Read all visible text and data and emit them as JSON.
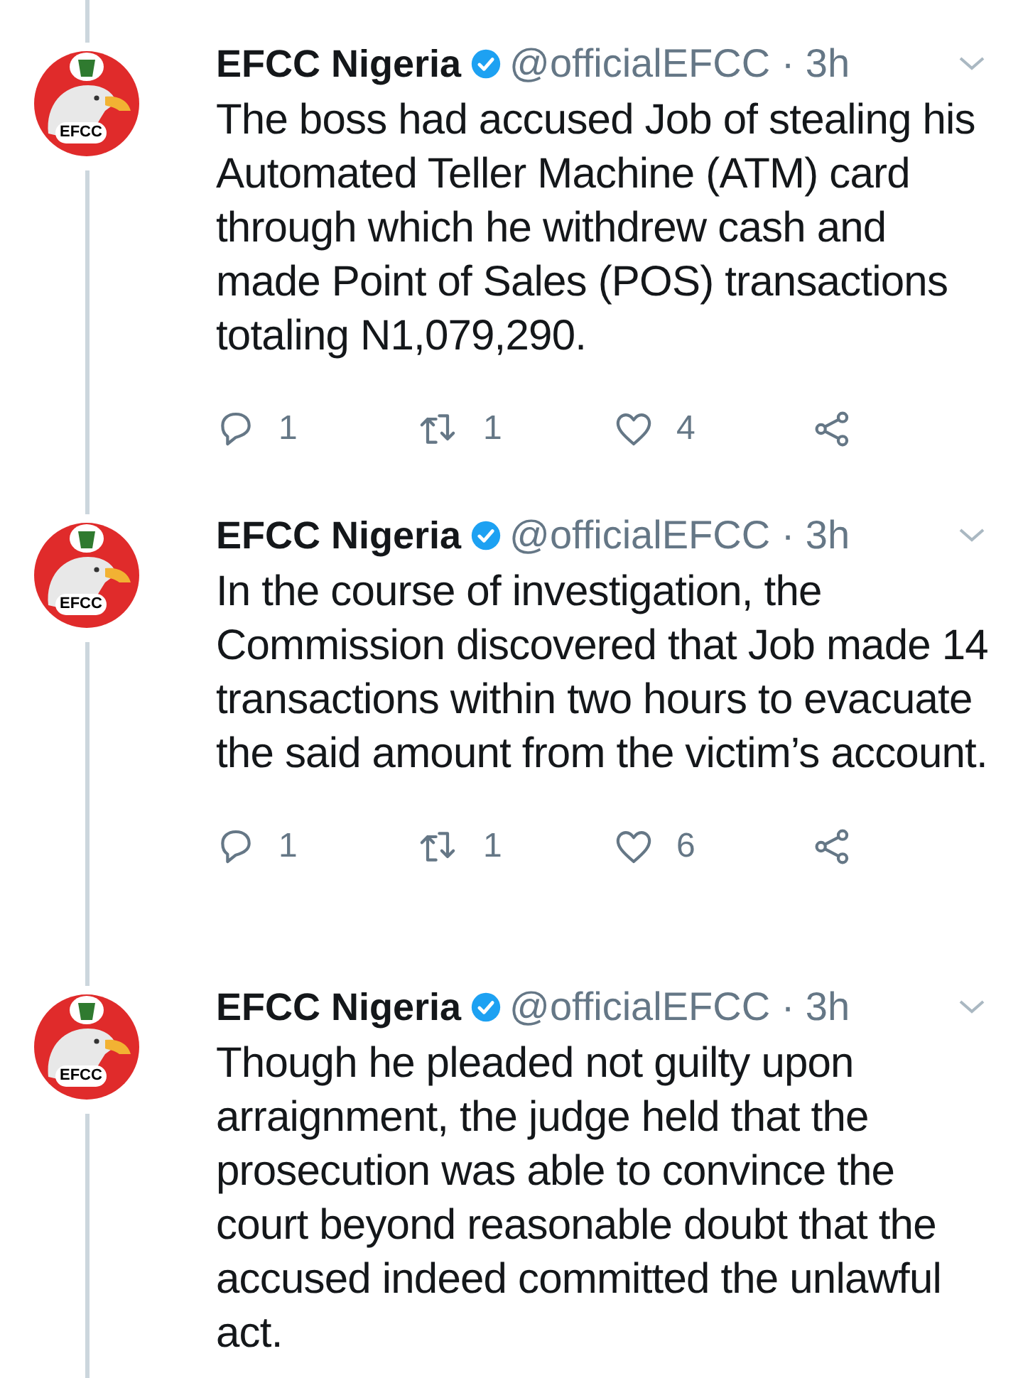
{
  "tweets": [
    {
      "name": "EFCC Nigeria",
      "verified": true,
      "handle": "@officialEFCC · 3h",
      "avatar_label": "EFCC",
      "text": "The boss had accused Job of stealing his Automated Teller Machine (ATM) card through which he withdrew cash and made Point of Sales (POS) transactions totaling N1,079,290.",
      "replies": "1",
      "retweets": "1",
      "likes": "4"
    },
    {
      "name": "EFCC Nigeria",
      "verified": true,
      "handle": "@officialEFCC · 3h",
      "avatar_label": "EFCC",
      "text": "In the course of investigation, the Commission discovered that Job made 14 transactions within two hours to evacuate the said amount from the victim’s account.",
      "replies": "1",
      "retweets": "1",
      "likes": "6"
    },
    {
      "name": "EFCC Nigeria",
      "verified": true,
      "handle": "@officialEFCC · 3h",
      "avatar_label": "EFCC",
      "text": "Though he pleaded not guilty upon arraignment, the judge held that the prosecution was able to convince the court beyond reasonable doubt that the accused indeed committed the unlawful act."
    }
  ]
}
